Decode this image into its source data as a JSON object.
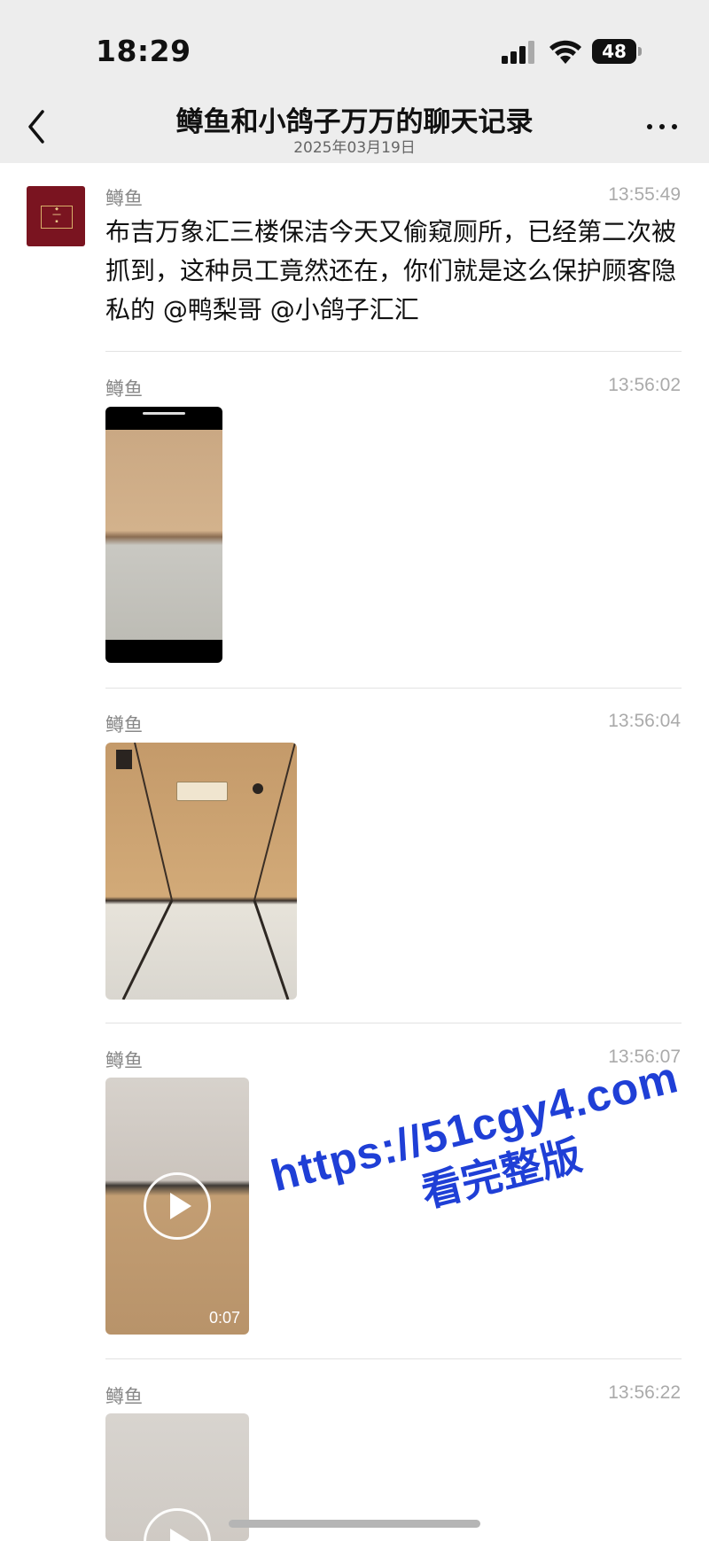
{
  "status_bar": {
    "time": "18:29",
    "battery": "48"
  },
  "nav": {
    "title": "鳟鱼和小鸽子万万的聊天记录",
    "subtitle": "2025年03月19日"
  },
  "messages": [
    {
      "sender": "鳟鱼",
      "time": "13:55:49",
      "text": "布吉万象汇三楼保洁今天又偷窥厕所，已经第二次被抓到，这种员工竟然还在，你们就是这么保护顾客隐私的 @鸭梨哥 @小鸽子汇汇"
    },
    {
      "sender": "鳟鱼",
      "time": "13:56:02",
      "type": "image"
    },
    {
      "sender": "鳟鱼",
      "time": "13:56:04",
      "type": "image"
    },
    {
      "sender": "鳟鱼",
      "time": "13:56:07",
      "type": "video",
      "duration": "0:07"
    },
    {
      "sender": "鳟鱼",
      "time": "13:56:22",
      "type": "video"
    }
  ],
  "watermark": {
    "url": "https://51cgy4.com",
    "text": "看完整版",
    "color": "#1f3fd6"
  },
  "icons": [
    "back-icon",
    "more-icon",
    "signal-icon",
    "wifi-icon",
    "battery-icon",
    "play-icon"
  ]
}
